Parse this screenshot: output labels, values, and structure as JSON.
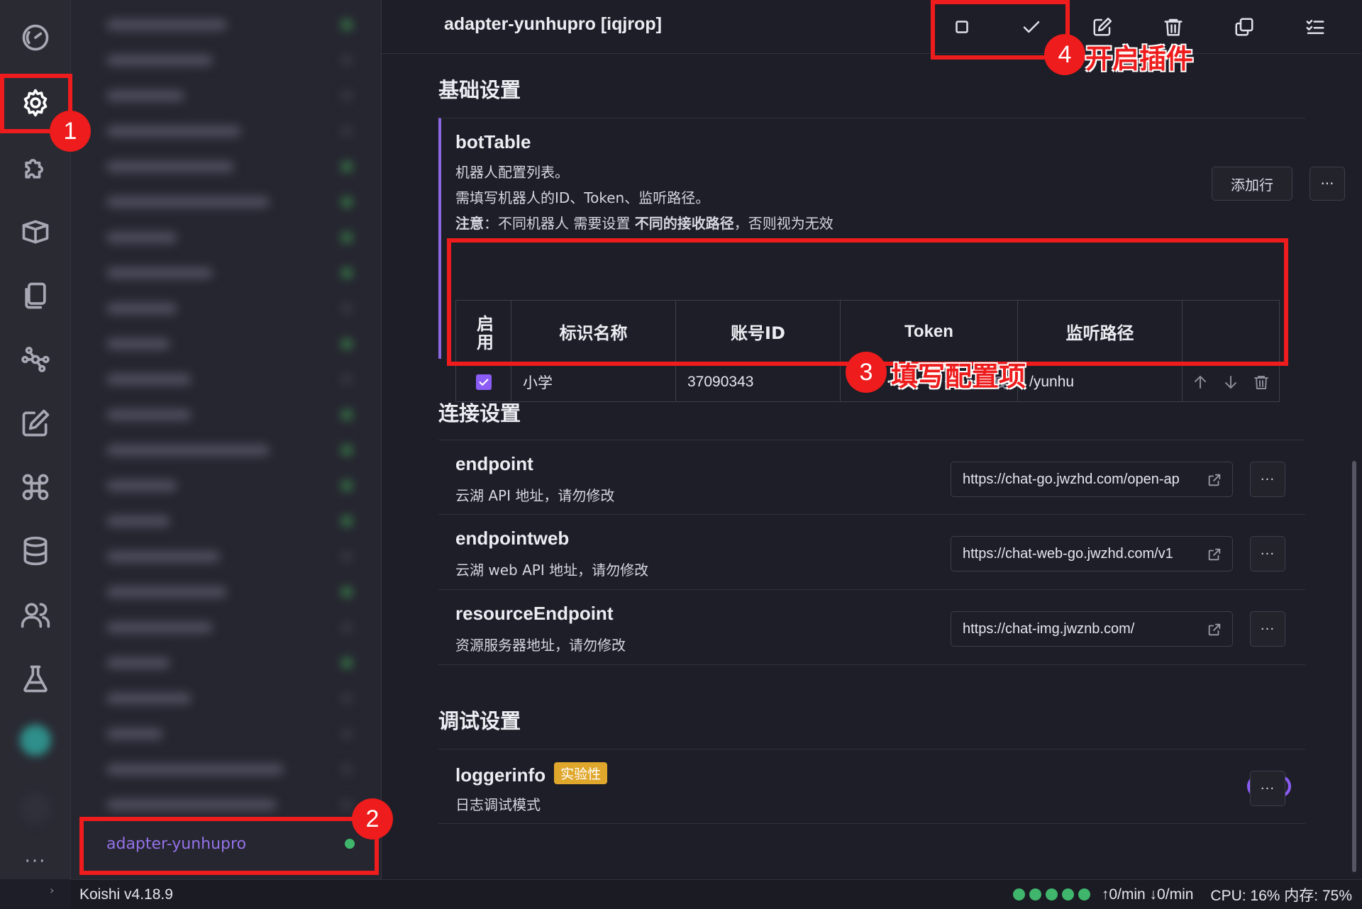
{
  "activity_bar": {
    "items": [
      {
        "name": "dashboard-icon"
      },
      {
        "name": "gear-icon",
        "active": true
      },
      {
        "name": "puzzle-icon"
      },
      {
        "name": "package-icon"
      },
      {
        "name": "files-icon"
      },
      {
        "name": "network-icon"
      },
      {
        "name": "edit-icon"
      },
      {
        "name": "command-icon"
      },
      {
        "name": "database-icon"
      },
      {
        "name": "users-icon"
      },
      {
        "name": "flask-icon"
      }
    ],
    "more_label": "···"
  },
  "plugin_list": {
    "selected_label": "adapter-yunhupro",
    "selected_status_color": "#3fb66b"
  },
  "header": {
    "title": "adapter-yunhupro [iqjrop]",
    "buttons": [
      "checkbox-icon",
      "check-icon",
      "edit-icon",
      "trash-icon",
      "copy-icon",
      "list-check-icon"
    ]
  },
  "sections": {
    "basic_title": "基础设置",
    "connection_title": "连接设置",
    "debug_title": "调试设置"
  },
  "bot_table": {
    "name": "botTable",
    "desc_line1": "机器人配置列表。",
    "desc_line2": "需填写机器人的ID、Token、监听路径。",
    "desc_note_prefix": "注意",
    "desc_note_mid": "：不同机器人 需要设置 ",
    "desc_note_bold": "不同的接收路径",
    "desc_note_suffix": "，否则视为无效",
    "add_row_label": "添加行",
    "more_label": "···",
    "headers": {
      "enable": "启用",
      "name": "标识名称",
      "account": "账号ID",
      "token": "Token",
      "path": "监听路径"
    },
    "row": {
      "enabled": true,
      "name": "小学",
      "account": "37090343",
      "token": "••••••••••••••••••••••••••",
      "path": "/yunhu"
    }
  },
  "connection": {
    "items": [
      {
        "name": "endpoint",
        "desc": "云湖 API 地址，请勿修改",
        "value": "https://chat-go.jwzhd.com/open-ap"
      },
      {
        "name": "endpointweb",
        "desc": "云湖 web API 地址，请勿修改",
        "value": "https://chat-web-go.jwzhd.com/v1"
      },
      {
        "name": "resourceEndpoint",
        "desc": "资源服务器地址，请勿修改",
        "value": "https://chat-img.jwznb.com/"
      }
    ],
    "more_label": "···"
  },
  "debug": {
    "name": "loggerinfo",
    "badge": "实验性",
    "desc": "日志调试模式",
    "toggle_on": true,
    "more_label": "···"
  },
  "status_bar": {
    "version": "Koishi v4.18.9",
    "traffic": "↑0/min ↓0/min",
    "resources": "CPU: 16% 内存: 75%",
    "collapse_arrow": "›"
  },
  "annotations": [
    {
      "number": "1"
    },
    {
      "number": "2"
    },
    {
      "number": "3",
      "label": "填写配置项"
    },
    {
      "number": "4",
      "label": "开启插件"
    }
  ],
  "colors": {
    "accent": "#8b5cf6",
    "annotation_red": "#ee1c1c",
    "badge_orange": "#e0a72d",
    "status_green": "#3fb66b"
  }
}
